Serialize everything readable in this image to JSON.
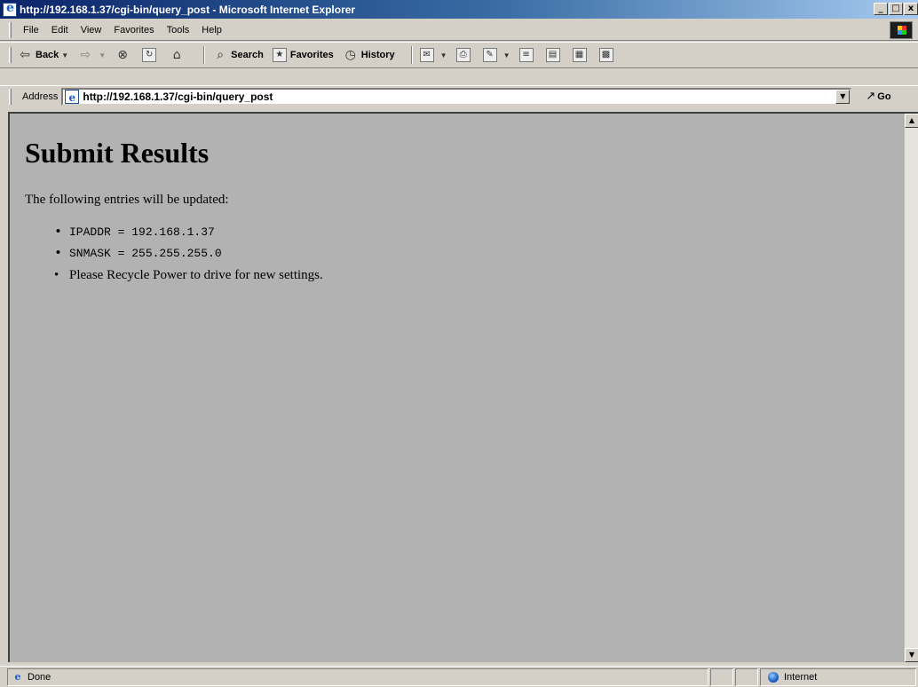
{
  "window": {
    "title": "http://192.168.1.37/cgi-bin/query_post - Microsoft Internet Explorer",
    "controls": {
      "minimize": "_",
      "maximize": "□",
      "close": "x"
    }
  },
  "menu": [
    "File",
    "Edit",
    "View",
    "Favorites",
    "Tools",
    "Help"
  ],
  "toolbar": {
    "back": "Back",
    "search": "Search",
    "favorites": "Favorites",
    "history": "History"
  },
  "address": {
    "label": "Address",
    "url": "http://192.168.1.37/cgi-bin/query_post",
    "go": "Go"
  },
  "page": {
    "heading": "Submit Results",
    "intro": "The following entries will be updated:",
    "entries": [
      {
        "text": "IPADDR = 192.168.1.37",
        "monospace": true
      },
      {
        "text": "SNMASK = 255.255.255.0",
        "monospace": true
      },
      {
        "text": "Please Recycle Power to drive for new settings.",
        "monospace": false
      }
    ]
  },
  "status": {
    "text": "Done",
    "zone": "Internet"
  },
  "icons": [
    "ie-page-icon",
    "back-arrow-icon",
    "forward-arrow-icon",
    "stop-icon",
    "refresh-icon",
    "home-icon",
    "search-icon",
    "favorites-icon",
    "history-icon",
    "mail-icon",
    "print-icon",
    "edit-icon",
    "discuss-icon",
    "go-arrow-icon",
    "globe-icon"
  ]
}
